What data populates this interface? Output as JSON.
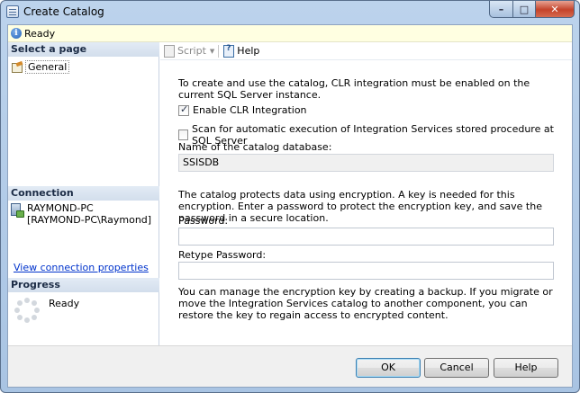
{
  "window": {
    "title": "Create Catalog",
    "caption_min": "–",
    "caption_max": "□",
    "caption_close": "✕"
  },
  "status": {
    "text": "Ready"
  },
  "sidebar": {
    "select_page_header": "Select a page",
    "pages": [
      {
        "label": "General"
      }
    ],
    "connection_header": "Connection",
    "server": "RAYMOND-PC",
    "user": "[RAYMOND-PC\\Raymond]",
    "view_connection_link": "View connection properties",
    "progress_header": "Progress",
    "progress_status": "Ready"
  },
  "toolbar": {
    "script_label": "Script",
    "help_label": "Help"
  },
  "form": {
    "clr_intro": "To create and use the catalog, CLR integration must be enabled on the current SQL Server instance.",
    "enable_clr_label": "Enable CLR Integration",
    "enable_clr_checked": true,
    "scan_label": "Scan for automatic execution of Integration Services stored procedure at SQL Server",
    "scan_checked": false,
    "catalog_db_label": "Name of the catalog database:",
    "catalog_db_value": "SSISDB",
    "encryption_intro": "The catalog protects data using encryption. A key is needed for this encryption. Enter a password to protect the encryption key, and save the password in a secure location.",
    "password_label": "Password:",
    "password_value": "",
    "retype_label": "Retype Password:",
    "retype_value": "",
    "backup_note": "You can manage the encryption key by creating a backup. If you migrate or move the Integration Services catalog to another component, you can restore the key to regain access to encrypted content."
  },
  "buttons": {
    "ok": "OK",
    "cancel": "Cancel",
    "help": "Help"
  }
}
